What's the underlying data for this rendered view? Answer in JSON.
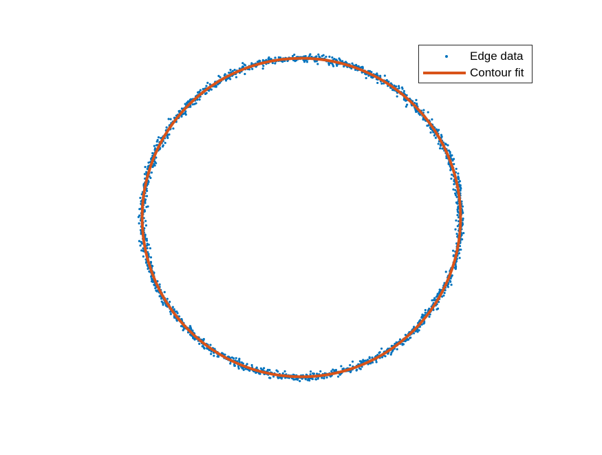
{
  "chart_data": {
    "type": "scatter",
    "title": "",
    "xlabel": "",
    "ylabel": "",
    "axes_visible": false,
    "grid": false,
    "legend_placement": "top-right",
    "aspect": "equal",
    "xlim": [
      -1.4,
      1.4
    ],
    "ylim": [
      -1.0,
      1.0
    ],
    "series": [
      {
        "name": "Edge data",
        "kind": "markers",
        "shape": "circle",
        "color": "#0072BD",
        "center": [
          0,
          0
        ],
        "radius": 1.0,
        "noise": 0.012,
        "count": 1800
      },
      {
        "name": "Contour fit",
        "kind": "line",
        "shape": "circle",
        "color": "#D95319",
        "center": [
          0,
          0
        ],
        "radius": 1.0
      }
    ]
  }
}
